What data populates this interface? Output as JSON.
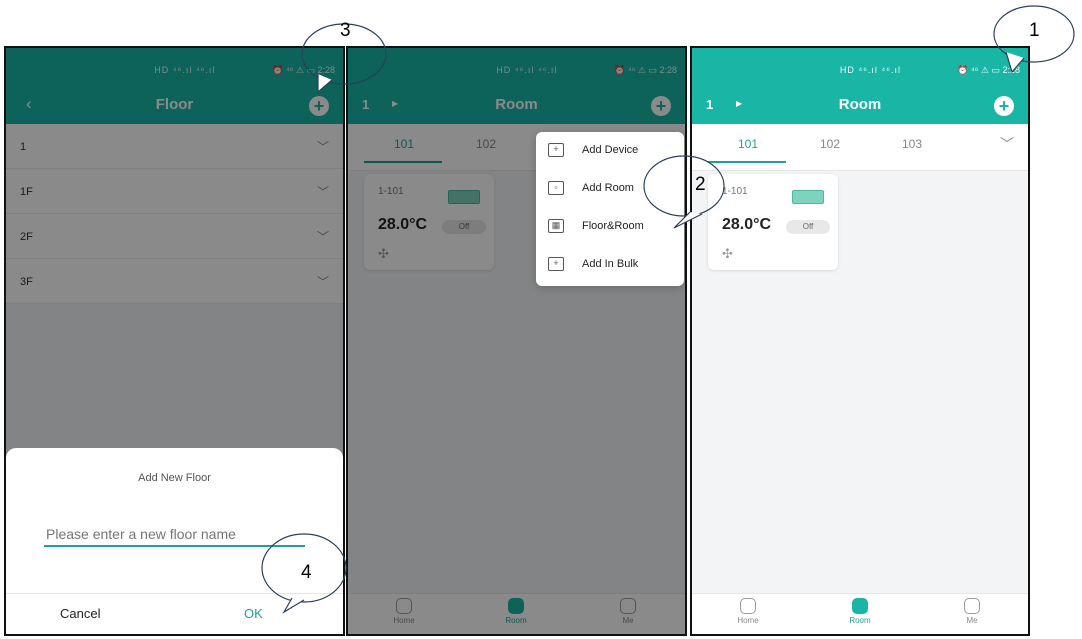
{
  "status_bar": {
    "signal": "HD ⁴⁶.ıl ⁴⁶.ıl",
    "right": "⏰ ⁴⁶ ⚠ ▭ 2:28"
  },
  "screen3": {
    "title": "Room",
    "floor": "1",
    "tabs": [
      "101",
      "102",
      "103"
    ],
    "device": {
      "name": "1-101",
      "temperature": "28.0°C",
      "state": "Off"
    },
    "nav": [
      "Home",
      "Room",
      "Me"
    ]
  },
  "screen2": {
    "title": "Room",
    "floor": "1",
    "tabs": [
      "101",
      "102"
    ],
    "device": {
      "name": "1-101",
      "temperature": "28.0°C",
      "state": "Off"
    },
    "menu": [
      "Add Device",
      "Add Room",
      "Floor&Room",
      "Add In Bulk"
    ],
    "nav": [
      "Home",
      "Room",
      "Me"
    ]
  },
  "screen1": {
    "title": "Floor",
    "floors": [
      "1",
      "1F",
      "2F",
      "3F"
    ],
    "dialog": {
      "title": "Add New Floor",
      "placeholder": "Please enter a new floor name",
      "cancel": "Cancel",
      "ok": "OK"
    }
  },
  "callouts": [
    "1",
    "2",
    "3",
    "4"
  ],
  "colors": {
    "accent": "#19b5a5",
    "accent_dark": "#19a596"
  },
  "icons": {
    "back": "chevron-left-icon",
    "add": "plus-circle-icon",
    "expand": "chevron-down-icon",
    "fan": "fan-icon",
    "device": "ac-unit-icon"
  }
}
